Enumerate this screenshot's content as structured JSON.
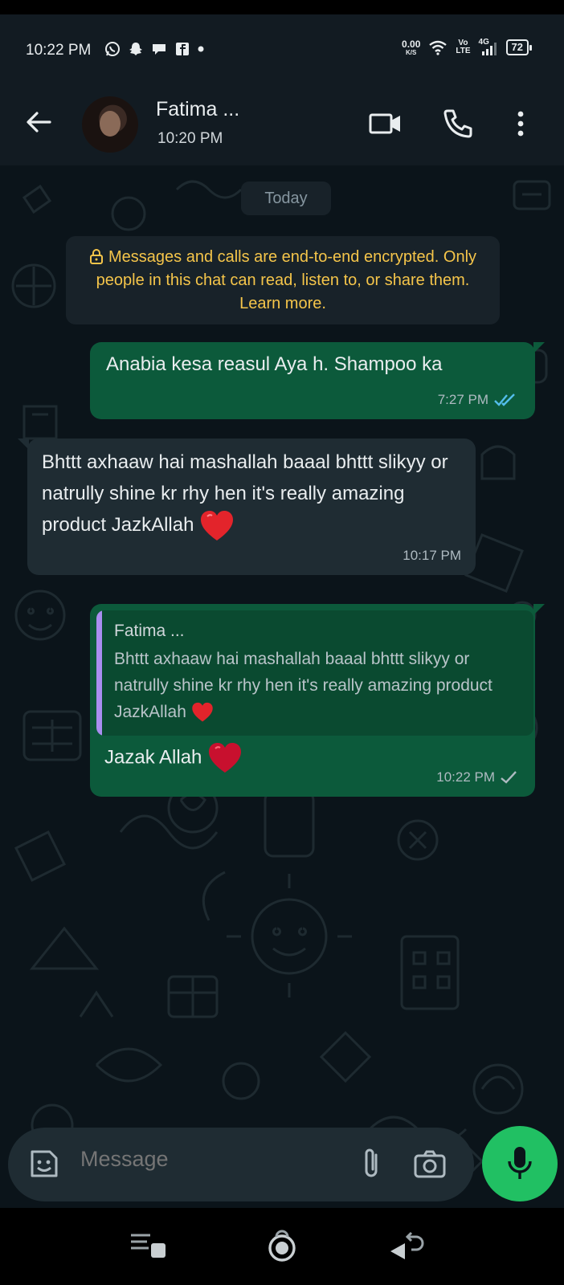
{
  "status_bar": {
    "time": "10:22 PM",
    "data_speed_value": "0.00",
    "data_speed_unit": "K/S",
    "network_top": "Vo",
    "network_bottom": "LTE",
    "network_gen": "4G",
    "battery": "72"
  },
  "header": {
    "contact_name": "Fatima ...",
    "subtitle": "10:20 PM"
  },
  "chat": {
    "date_chip": "Today",
    "encryption_notice": "Messages and calls are end-to-end encrypted. Only people in this chat can read, listen to, or share them. Learn more.",
    "messages": [
      {
        "direction": "outgoing",
        "text": "Anabia  kesa  reasul  Aya h. Shampoo ka",
        "time": "7:27 PM",
        "status": "read"
      },
      {
        "direction": "incoming",
        "text": "Bhttt axhaaw hai mashallah baaal bhttt slikyy or natrully shine kr rhy hen it's really amazing product JazkAllah",
        "emoji": "red-heart",
        "time": "10:17 PM"
      },
      {
        "direction": "outgoing",
        "quote_name": "Fatima ...",
        "quote_text": "Bhttt axhaaw hai mashallah baaal bhttt slikyy or natrully shine kr rhy hen it's really amazing product JazkAllah",
        "text": "Jazak Allah",
        "emoji": "red-heart",
        "time": "10:22 PM",
        "status": "sent"
      }
    ]
  },
  "composer": {
    "placeholder": "Message"
  },
  "colors": {
    "outgoing_bubble": "#0c5a3b",
    "incoming_bubble": "#1f2c33",
    "accent_green": "#21c063",
    "encryption_text": "#f5c54a",
    "read_ticks": "#53bdeb",
    "quote_bar": "#a98ef0"
  }
}
